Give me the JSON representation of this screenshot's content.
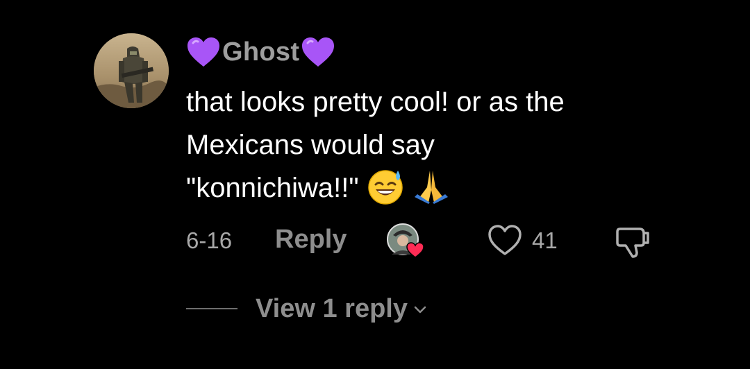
{
  "comment": {
    "author": {
      "name": "Ghost",
      "avatar_icon": "soldier-avatar",
      "name_decoration_icon": "purple-heart-icon"
    },
    "text_lines": [
      "that looks pretty cool! or as the",
      "Mexicans would say",
      "\"konnichiwa!!\""
    ],
    "emojis": [
      "sweat-smile-emoji",
      "folded-hands-emoji"
    ],
    "date": "6-16",
    "reply_label": "Reply",
    "like_count": "41",
    "creator_liked_icon": "creator-liked-avatar-icon",
    "view_replies_label": "View 1 reply"
  },
  "colors": {
    "background": "#000000",
    "text_primary": "#ffffff",
    "text_secondary": "#9e9e9e",
    "heart_purple": "#a855f7",
    "like_heart_red": "#ff2c55"
  }
}
